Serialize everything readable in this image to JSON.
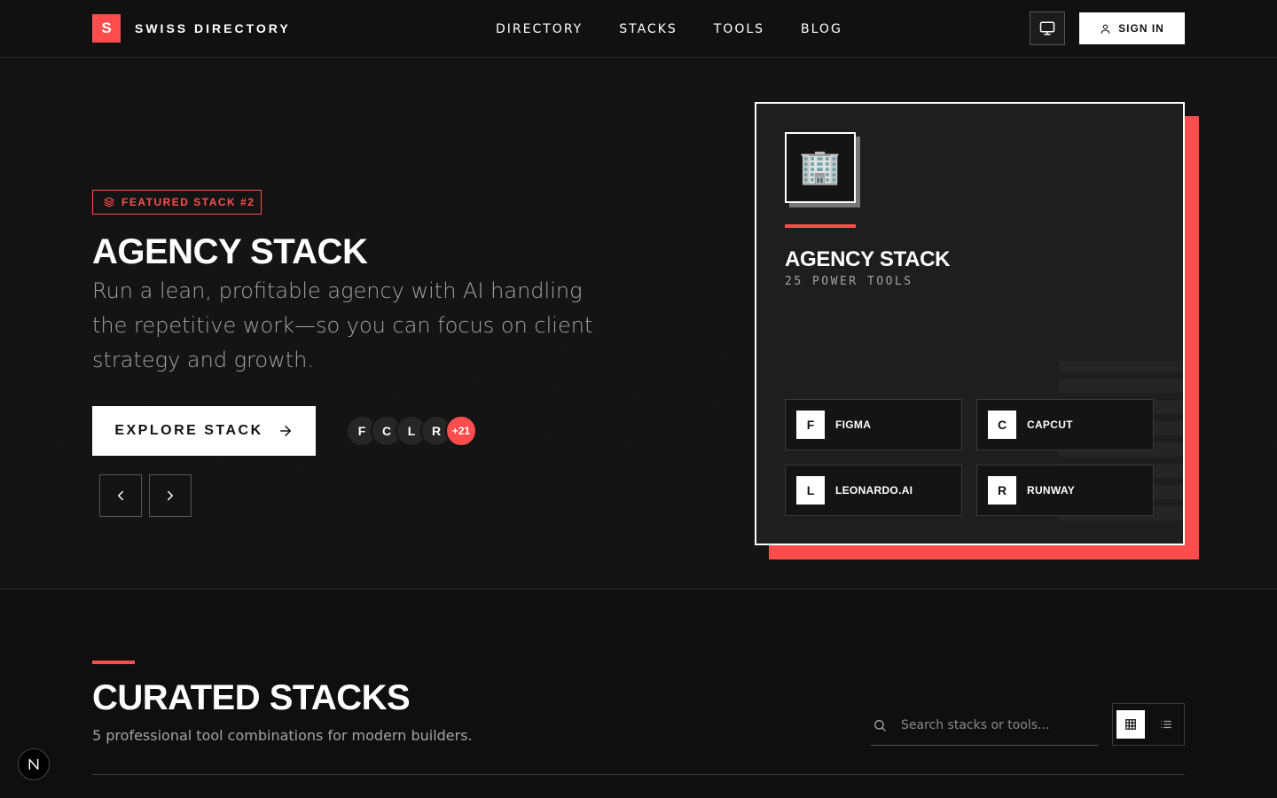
{
  "header": {
    "logo_letter": "S",
    "logo_text": "SWISS DIRECTORY",
    "nav": [
      "DIRECTORY",
      "STACKS",
      "TOOLS",
      "BLOG"
    ],
    "signin_label": "SIGN IN",
    "icons": {
      "theme": "monitor-icon",
      "signin": "user-icon"
    }
  },
  "hero": {
    "badge": "FEATURED STACK #2",
    "title": "AGENCY STACK",
    "description": "Run a lean, profitable agency with AI handling the repetitive work—so you can focus on client strategy and growth.",
    "cta_label": "EXPLORE STACK",
    "avatars": [
      "F",
      "C",
      "L",
      "R"
    ],
    "avatars_more": "+21",
    "icons": {
      "badge": "layers-icon",
      "cta": "arrow-right-icon",
      "prev": "chevron-left-icon",
      "next": "chevron-right-icon"
    }
  },
  "feature_card": {
    "emoji": "🏢",
    "title": "AGENCY STACK",
    "subtitle": "25 POWER TOOLS",
    "tools": [
      {
        "letter": "F",
        "name": "FIGMA"
      },
      {
        "letter": "C",
        "name": "CAPCUT"
      },
      {
        "letter": "L",
        "name": "LEONARDO.AI"
      },
      {
        "letter": "R",
        "name": "RUNWAY"
      }
    ]
  },
  "curated": {
    "title": "CURATED STACKS",
    "subtitle": "5 professional tool combinations for modern builders.",
    "search_placeholder": "Search stacks or tools...",
    "icons": {
      "search": "search-icon",
      "grid": "grid-icon",
      "list": "list-icon"
    }
  },
  "colors": {
    "accent": "#ff4d4d",
    "background": "#0f0f0f",
    "surface": "#1e1e1e",
    "text_muted": "#a3a3a3"
  }
}
